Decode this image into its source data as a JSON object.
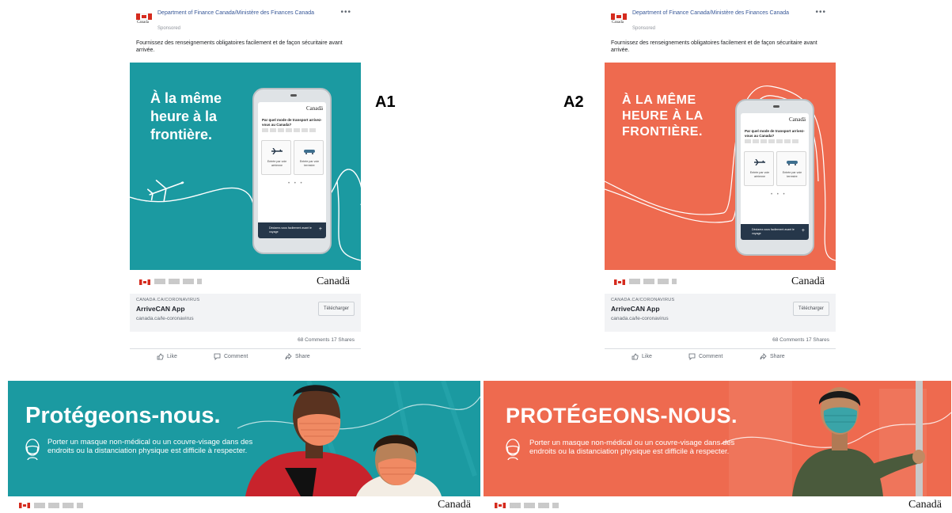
{
  "posts": [
    {
      "id": "a1",
      "page_name": "Department of Finance Canada/Ministère des Finances Canada",
      "sponsored": "Sponsored",
      "more": "•••",
      "text": "Fournissez des renseignements obligatoires facilement et de façon sécuritaire avant arrivée.",
      "headline": "À la même heure à la frontière.",
      "phone": {
        "brand": "Canadä",
        "question": "Par quel mode de transport arrivez-vous au Canada?",
        "option_air": "Entrée par voie aérienne",
        "option_land": "Entrée par voie terrestre",
        "dots": "• • •",
        "bar_text": "Déclarez-vous facilement avant le voyage",
        "bar_icon": "+"
      },
      "signature_wordmark": "Canadä",
      "link": {
        "domain": "CANADA.CA/CORONAVIRUS",
        "title": "ArriveCAN App",
        "url": "canada.ca/le-coronavirus",
        "cta": "Télécharger"
      },
      "counts": "68 Comments  17 Shares",
      "actions": {
        "like": "Like",
        "comment": "Comment",
        "share": "Share"
      },
      "version_label": "A1"
    },
    {
      "id": "a2",
      "page_name": "Department of Finance Canada/Ministère des Finances Canada",
      "sponsored": "Sponsored",
      "more": "•••",
      "text": "Fournissez des renseignements obligatoires facilement et de façon sécuritaire avant arrivée.",
      "headline": "À LA MÊME HEURE À LA FRONTIÈRE.",
      "phone": {
        "brand": "Canadä",
        "question": "Par quel mode de transport arrivez-vous au Canada?",
        "option_air": "Entrée par voie aérienne",
        "option_land": "Entrée par voie terrestre",
        "dots": "• • •",
        "bar_text": "Déclarez-vous facilement avant le voyage",
        "bar_icon": "+"
      },
      "signature_wordmark": "Canadä",
      "link": {
        "domain": "CANADA.CA/CORONAVIRUS",
        "title": "ArriveCAN App",
        "url": "canada.ca/le-coronavirus",
        "cta": "Télécharger"
      },
      "counts": "68 Comments  17 Shares",
      "actions": {
        "like": "Like",
        "comment": "Comment",
        "share": "Share"
      },
      "version_label": "A2"
    }
  ],
  "banners": [
    {
      "title": "Protégeons-nous.",
      "text": "Porter un masque non-médical ou un couvre-visage dans des endroits ou la distanciation physique est difficile à respecter.",
      "wordmark": "Canadä"
    },
    {
      "title": "PROTÉGEONS-NOUS.",
      "text": "Porter un masque non-médical ou un couvre-visage dans des endroits ou la distanciation physique est difficile à respecter.",
      "wordmark": "Canadä"
    }
  ],
  "colors": {
    "teal": "#1b9aa1",
    "coral": "#ee6a4f",
    "canada_red": "#d52b1e",
    "facebook_blue": "#385898"
  }
}
